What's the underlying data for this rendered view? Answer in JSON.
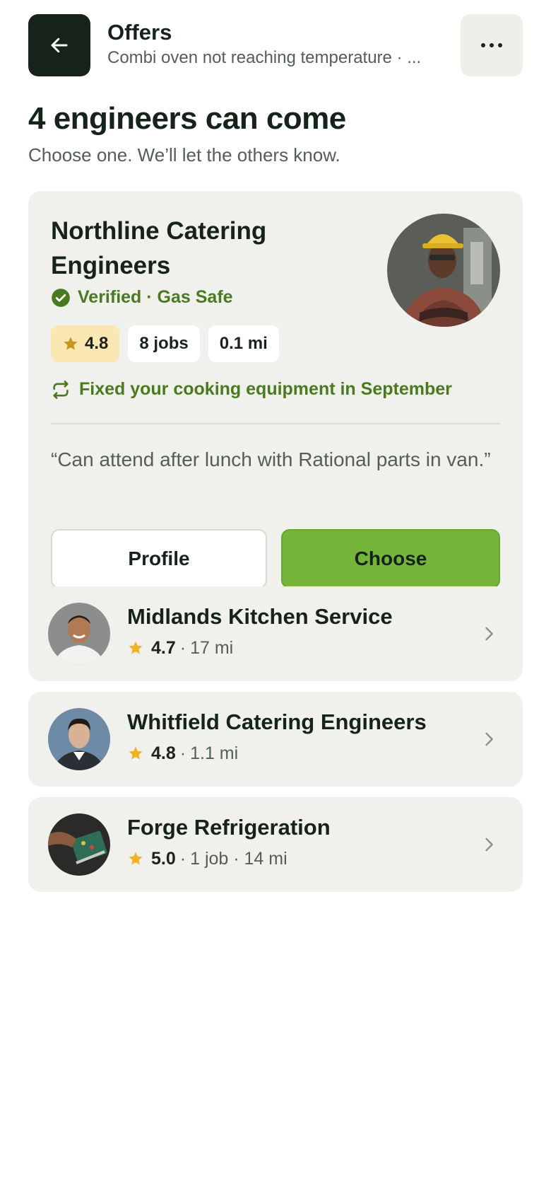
{
  "header": {
    "title": "Offers",
    "subtitle": "Combi oven not reaching temperature · ..."
  },
  "page": {
    "title": "4 engineers can come",
    "subtitle": "Choose one. We’ll let the others know."
  },
  "featured": {
    "name": "Northline Catering Engineers",
    "verified": "Verified · Gas Safe",
    "rating": "4.8",
    "jobs": "8 jobs",
    "distance": "0.1 mi",
    "history": "Fixed your cooking equipment in September",
    "quote": "“Can attend after lunch with Rational parts in van.”",
    "profile_label": "Profile",
    "choose_label": "Choose"
  },
  "others": [
    {
      "name": "Midlands Kitchen Service",
      "rating": "4.7",
      "details": "17 mi"
    },
    {
      "name": "Whitfield Catering Engineers",
      "rating": "4.8",
      "details": "1.1 mi"
    },
    {
      "name": "Forge Refrigeration",
      "rating": "5.0",
      "details": "1 job · 14 mi"
    }
  ],
  "colors": {
    "accent": "#76b53c",
    "dark": "#16231b",
    "verified_green": "#4a7a20",
    "star": "#f0b323",
    "card_bg": "#f0f0ec"
  },
  "icons": [
    "arrow-left-icon",
    "more-horizontal-icon",
    "check-badge-icon",
    "star-icon",
    "repeat-icon",
    "chevron-right-icon"
  ]
}
